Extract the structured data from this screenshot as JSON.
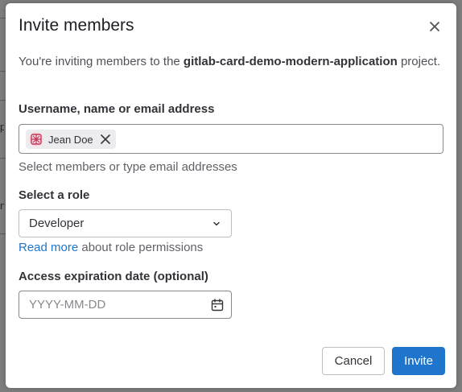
{
  "modal": {
    "title": "Invite members",
    "intro_prefix": "You're inviting members to the ",
    "project_name": "gitlab-card-demo-modern-application",
    "intro_suffix": " project."
  },
  "username_field": {
    "label": "Username, name or email address",
    "tokens": [
      {
        "label": "Jean Doe"
      }
    ],
    "helper": "Select members or type email addresses"
  },
  "role_field": {
    "label": "Select a role",
    "selected": "Developer",
    "link_text": "Read more",
    "link_suffix": " about role permissions"
  },
  "expiration_field": {
    "label": "Access expiration date (optional)",
    "placeholder": "YYYY-MM-DD"
  },
  "buttons": {
    "cancel": "Cancel",
    "invite": "Invite"
  },
  "colors": {
    "primary": "#1f75cb",
    "text": "#333238",
    "muted": "#626168",
    "avatar_bg": "#f6d9e0",
    "avatar_fg": "#c0395a"
  },
  "icons": {
    "close": "close-icon",
    "remove_token": "close-icon",
    "chevron": "chevron-down-icon",
    "calendar": "calendar-icon",
    "avatar": "identicon-avatar"
  }
}
